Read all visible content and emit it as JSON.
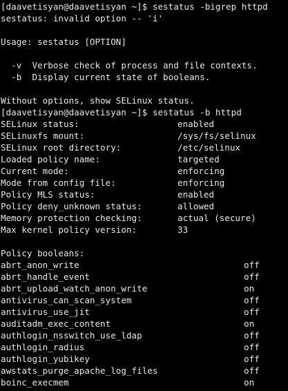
{
  "terminal": {
    "block1": [
      "[daavetisyan@daavetisyan ~]$ sestatus -bigrep httpd",
      "sestatus: invalid option -- 'i'",
      "",
      "Usage: sestatus [OPTION]",
      "",
      "  -v  Verbose check of process and file contexts.",
      "  -b  Display current state of booleans.",
      "",
      "Without options, show SELinux status.",
      "[daavetisyan@daavetisyan ~]$ sestatus -b httpd"
    ],
    "status": [
      {
        "key": "SELinux status:",
        "value": "enabled"
      },
      {
        "key": "SELinuxfs mount:",
        "value": "/sys/fs/selinux"
      },
      {
        "key": "SELinux root directory:",
        "value": "/etc/selinux"
      },
      {
        "key": "Loaded policy name:",
        "value": "targeted"
      },
      {
        "key": "Current mode:",
        "value": "enforcing"
      },
      {
        "key": "Mode from config file:",
        "value": "enforcing"
      },
      {
        "key": "Policy MLS status:",
        "value": "enabled"
      },
      {
        "key": "Policy deny_unknown status:",
        "value": "allowed"
      },
      {
        "key": "Memory protection checking:",
        "value": "actual (secure)"
      },
      {
        "key": "Max kernel policy version:",
        "value": "33"
      }
    ],
    "booleans_header": "Policy booleans:",
    "booleans": [
      {
        "name": "abrt_anon_write",
        "state": "off"
      },
      {
        "name": "abrt_handle_event",
        "state": "off"
      },
      {
        "name": "abrt_upload_watch_anon_write",
        "state": "on"
      },
      {
        "name": "antivirus_can_scan_system",
        "state": "off"
      },
      {
        "name": "antivirus_use_jit",
        "state": "off"
      },
      {
        "name": "auditadm_exec_content",
        "state": "on"
      },
      {
        "name": "authlogin_nsswitch_use_ldap",
        "state": "off"
      },
      {
        "name": "authlogin_radius",
        "state": "off"
      },
      {
        "name": "authlogin_yubikey",
        "state": "off"
      },
      {
        "name": "awstats_purge_apache_log_files",
        "state": "off"
      },
      {
        "name": "boinc_execmem",
        "state": "on"
      }
    ],
    "colors": {
      "background": "#000000",
      "foreground": "#e8e8e8"
    }
  }
}
